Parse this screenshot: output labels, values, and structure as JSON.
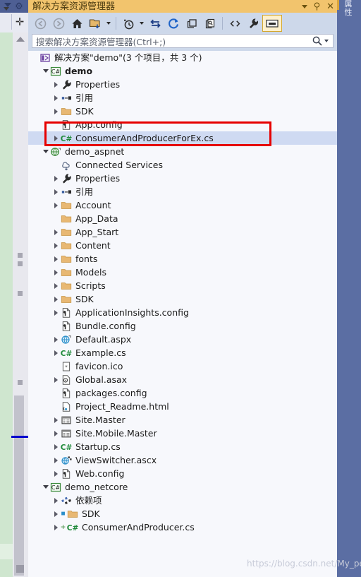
{
  "window": {
    "title": "解决方案资源管理器",
    "buttons": [
      {
        "name": "window-menu-button",
        "glyph": "▾"
      },
      {
        "name": "auto-hide-pin-button",
        "glyph": "⇅"
      },
      {
        "name": "close-button",
        "glyph": "✕"
      }
    ]
  },
  "left_panel": {
    "gear_icon": "⚙",
    "split_glyph": "✛"
  },
  "right_dock": {
    "tab_label": "属性"
  },
  "toolbar": {
    "items": [
      {
        "name": "back-button",
        "icon": "arrow-left-circle-icon",
        "enabled": false
      },
      {
        "name": "forward-button",
        "icon": "arrow-right-circle-icon",
        "enabled": false
      },
      {
        "name": "home-button",
        "icon": "home-icon",
        "enabled": true
      },
      {
        "name": "pending-changes-filter-button",
        "icon": "folder-filter-icon",
        "enabled": true
      },
      {
        "name": "pending-changes-dropdown",
        "icon": "chevron-down-icon",
        "enabled": true
      },
      {
        "name": "separator-1",
        "icon": "separator",
        "enabled": false
      },
      {
        "name": "show-history-button",
        "icon": "clock-icon",
        "enabled": true
      },
      {
        "name": "show-history-dropdown",
        "icon": "chevron-down-icon",
        "enabled": true
      },
      {
        "name": "sync-button",
        "icon": "sync-arrows-icon",
        "enabled": true
      },
      {
        "name": "refresh-button",
        "icon": "refresh-circular-icon",
        "enabled": true
      },
      {
        "name": "collapse-all-button",
        "icon": "collapse-all-icon",
        "enabled": true
      },
      {
        "name": "show-all-files-button",
        "icon": "show-all-files-icon",
        "enabled": true
      },
      {
        "name": "separator-2",
        "icon": "separator",
        "enabled": false
      },
      {
        "name": "view-code-button",
        "icon": "angle-brackets-icon",
        "enabled": true
      },
      {
        "name": "properties-button",
        "icon": "wrench-icon",
        "enabled": true
      },
      {
        "name": "preview-selected-items-button",
        "icon": "preview-pane-icon",
        "enabled": true,
        "active": true
      }
    ]
  },
  "search": {
    "placeholder": "搜索解决方案资源管理器(Ctrl+;)",
    "icon": "magnifier-icon",
    "dropdown_icon": "chevron-down-icon"
  },
  "tree": {
    "nodes": [
      {
        "indent": 0,
        "twisty": "none",
        "icon": "solution-icon",
        "label": "解决方案\"demo\"(3 个项目，共 3 个)",
        "bold": false
      },
      {
        "indent": 1,
        "twisty": "open",
        "icon": "csharp-project-icon",
        "label": "demo",
        "bold": true
      },
      {
        "indent": 2,
        "twisty": "closed",
        "icon": "wrench-icon",
        "label": "Properties"
      },
      {
        "indent": 2,
        "twisty": "closed",
        "icon": "references-icon",
        "label": "引用"
      },
      {
        "indent": 2,
        "twisty": "closed",
        "icon": "folder-icon",
        "label": "SDK"
      },
      {
        "indent": 2,
        "twisty": "none",
        "icon": "config-file-icon",
        "label": "App.config"
      },
      {
        "indent": 2,
        "twisty": "closed",
        "icon": "csharp-file-icon",
        "label": "ConsumerAndProducerForEx.cs",
        "selected": true
      },
      {
        "indent": 1,
        "twisty": "open",
        "icon": "web-project-icon",
        "label": "demo_aspnet"
      },
      {
        "indent": 2,
        "twisty": "none",
        "icon": "connected-services-icon",
        "label": "Connected Services"
      },
      {
        "indent": 2,
        "twisty": "closed",
        "icon": "wrench-icon",
        "label": "Properties"
      },
      {
        "indent": 2,
        "twisty": "closed",
        "icon": "references-icon",
        "label": "引用"
      },
      {
        "indent": 2,
        "twisty": "closed",
        "icon": "folder-icon",
        "label": "Account"
      },
      {
        "indent": 2,
        "twisty": "none",
        "icon": "folder-icon",
        "label": "App_Data"
      },
      {
        "indent": 2,
        "twisty": "closed",
        "icon": "folder-icon",
        "label": "App_Start"
      },
      {
        "indent": 2,
        "twisty": "closed",
        "icon": "folder-icon",
        "label": "Content"
      },
      {
        "indent": 2,
        "twisty": "closed",
        "icon": "folder-icon",
        "label": "fonts"
      },
      {
        "indent": 2,
        "twisty": "closed",
        "icon": "folder-icon",
        "label": "Models"
      },
      {
        "indent": 2,
        "twisty": "closed",
        "icon": "folder-icon",
        "label": "Scripts"
      },
      {
        "indent": 2,
        "twisty": "closed",
        "icon": "folder-icon",
        "label": "SDK"
      },
      {
        "indent": 2,
        "twisty": "closed",
        "icon": "config-file-icon",
        "label": "ApplicationInsights.config"
      },
      {
        "indent": 2,
        "twisty": "none",
        "icon": "config-file-icon",
        "label": "Bundle.config"
      },
      {
        "indent": 2,
        "twisty": "closed",
        "icon": "aspx-page-icon",
        "label": "Default.aspx"
      },
      {
        "indent": 2,
        "twisty": "closed",
        "icon": "csharp-file-icon",
        "label": "Example.cs"
      },
      {
        "indent": 2,
        "twisty": "none",
        "icon": "ico-file-icon",
        "label": "favicon.ico"
      },
      {
        "indent": 2,
        "twisty": "closed",
        "icon": "global-asax-icon",
        "label": "Global.asax"
      },
      {
        "indent": 2,
        "twisty": "none",
        "icon": "config-file-icon",
        "label": "packages.config"
      },
      {
        "indent": 2,
        "twisty": "none",
        "icon": "html-file-icon",
        "label": "Project_Readme.html"
      },
      {
        "indent": 2,
        "twisty": "closed",
        "icon": "master-page-icon",
        "label": "Site.Master"
      },
      {
        "indent": 2,
        "twisty": "closed",
        "icon": "master-page-icon",
        "label": "Site.Mobile.Master"
      },
      {
        "indent": 2,
        "twisty": "closed",
        "icon": "csharp-file-icon",
        "label": "Startup.cs"
      },
      {
        "indent": 2,
        "twisty": "closed",
        "icon": "ascx-control-icon",
        "label": "ViewSwitcher.ascx"
      },
      {
        "indent": 2,
        "twisty": "closed",
        "icon": "config-file-icon",
        "label": "Web.config"
      },
      {
        "indent": 1,
        "twisty": "open",
        "icon": "csharp-project-icon",
        "label": "demo_netcore"
      },
      {
        "indent": 2,
        "twisty": "closed",
        "icon": "dependencies-icon",
        "label": "依赖项"
      },
      {
        "indent": 2,
        "twisty": "closed",
        "icon": "folder-icon",
        "label": "SDK",
        "badge": "lock"
      },
      {
        "indent": 2,
        "twisty": "closed",
        "icon": "csharp-file-icon",
        "label": "ConsumerAndProducer.cs",
        "badge": "plus"
      }
    ]
  },
  "annotation": {
    "highlight_box_color": "#e60000",
    "highlight_target": "ConsumerAndProducerForEx.cs"
  },
  "watermark": {
    "text": "https://blog.csdn.net/My_pen"
  }
}
